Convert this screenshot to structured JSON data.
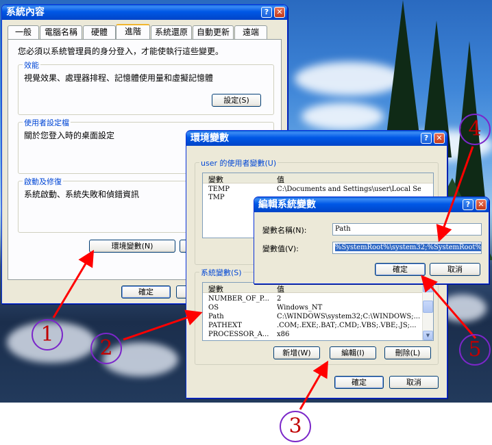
{
  "sysprop": {
    "title": "系統內容",
    "tabs": [
      "一般",
      "電腦名稱",
      "硬體",
      "進階",
      "系統還原",
      "自動更新",
      "遠端"
    ],
    "active_tab": "進階",
    "notice": "您必須以系統管理員的身分登入，才能使執行這些變更。",
    "perf_title": "效能",
    "perf_desc": "視覺效果、處理器排程、記憶體使用量和虛擬記憶體",
    "perf_btn": "設定(S)",
    "profile_title": "使用者設定檔",
    "profile_desc": "關於您登入時的桌面設定",
    "startup_title": "啟動及修復",
    "startup_desc": "系統啟動、系統失敗和偵錯資訊",
    "env_btn": "環境變數(N)",
    "ok": "確定"
  },
  "envvars": {
    "title": "環境變數",
    "user_group": "user 的使用者變數(U)",
    "col_var": "變數",
    "col_val": "值",
    "user_rows": [
      {
        "name": "TEMP",
        "value": "C:\\Documents and Settings\\user\\Local Set..."
      },
      {
        "name": "TMP",
        "value": ""
      }
    ],
    "sys_group": "系統變數(S)",
    "sys_rows": [
      {
        "name": "NUMBER_OF_P...",
        "value": "2"
      },
      {
        "name": "OS",
        "value": "Windows_NT"
      },
      {
        "name": "Path",
        "value": "C:\\WINDOWS\\system32;C:\\WINDOWS;..."
      },
      {
        "name": "PATHEXT",
        "value": ".COM;.EXE;.BAT;.CMD;.VBS;.VBE;.JS;..."
      },
      {
        "name": "PROCESSOR_A...",
        "value": "x86"
      }
    ],
    "new_btn": "新增(W)",
    "edit_btn": "編輯(I)",
    "del_btn": "刪除(L)",
    "ok": "確定",
    "cancel": "取消"
  },
  "editvar": {
    "title": "編輯系統變數",
    "name_label": "變數名稱(N):",
    "name_value": "Path",
    "value_label": "變數值(V):",
    "value_value": "%SystemRoot%\\system32;%SystemRoot%;%",
    "ok": "確定",
    "cancel": "取消"
  },
  "annotations": {
    "badges": [
      "1",
      "2",
      "3",
      "4",
      "5"
    ],
    "arrow_color": "#ff0000",
    "circle_color": "#7b27c9",
    "number_color": "#c00000"
  },
  "titlebar_buttons": {
    "help": "?",
    "close": "✕"
  }
}
